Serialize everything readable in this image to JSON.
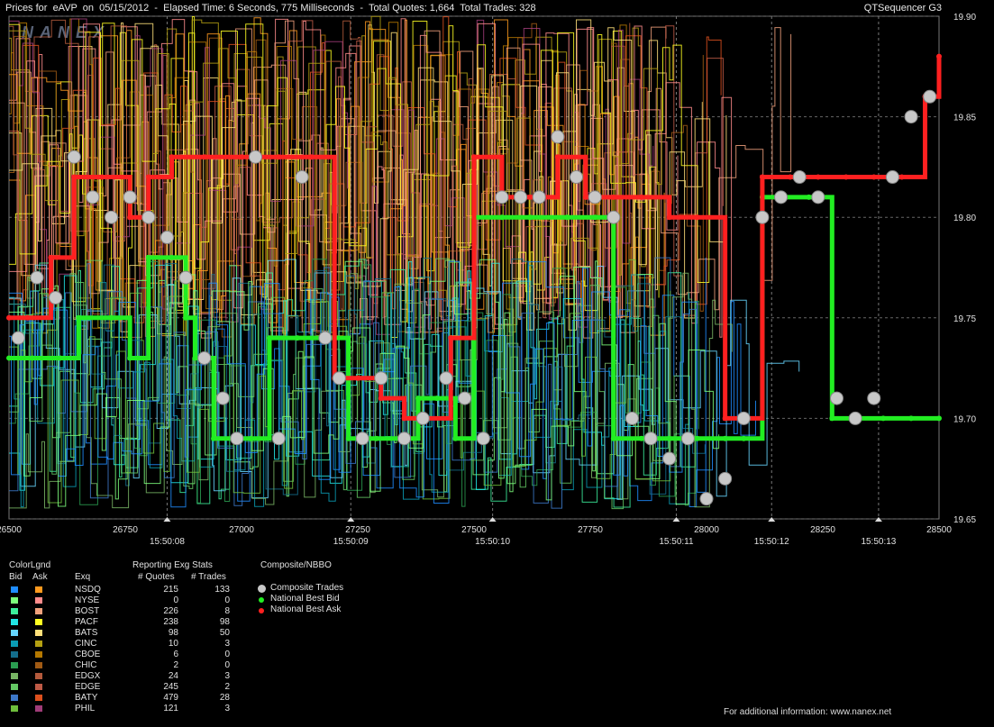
{
  "header": {
    "title": "Prices for  eAVP  on  05/15/2012  -  Elapsed Time: 6 Seconds, 775 Milliseconds  -  Total Quotes: 1,664  Total Trades: 328",
    "app": "QTSequencer G3"
  },
  "watermark": "NANEX",
  "chart_data": {
    "type": "line",
    "y_axis": {
      "min": 19.65,
      "max": 19.9,
      "ticks": [
        "19.90",
        "19.85",
        "19.80",
        "19.75",
        "19.70",
        "19.65"
      ]
    },
    "x_axis": {
      "min": 26500,
      "max": 28500,
      "ticks": [
        "26500",
        "26750",
        "27000",
        "27250",
        "27500",
        "27750",
        "28000",
        "28250",
        "28500"
      ],
      "time_labels": [
        {
          "at": 26840,
          "label": "15:50:08"
        },
        {
          "at": 27235,
          "label": "15:50:09"
        },
        {
          "at": 27540,
          "label": "15:50:10"
        },
        {
          "at": 27935,
          "label": "15:50:11"
        },
        {
          "at": 28140,
          "label": "15:50:12"
        },
        {
          "at": 28370,
          "label": "15:50:13"
        }
      ]
    },
    "series": [
      {
        "name": "National Best Bid",
        "color": "#22ee22",
        "points": [
          [
            26500,
            19.73
          ],
          [
            26550,
            19.73
          ],
          [
            26610,
            19.73
          ],
          [
            26650,
            19.75
          ],
          [
            26720,
            19.75
          ],
          [
            26760,
            19.73
          ],
          [
            26800,
            19.78
          ],
          [
            26850,
            19.78
          ],
          [
            26880,
            19.75
          ],
          [
            26900,
            19.73
          ],
          [
            26940,
            19.69
          ],
          [
            26980,
            19.69
          ],
          [
            27020,
            19.69
          ],
          [
            27060,
            19.74
          ],
          [
            27120,
            19.74
          ],
          [
            27180,
            19.74
          ],
          [
            27230,
            19.69
          ],
          [
            27290,
            19.69
          ],
          [
            27340,
            19.69
          ],
          [
            27380,
            19.71
          ],
          [
            27420,
            19.71
          ],
          [
            27460,
            19.69
          ],
          [
            27500,
            19.8
          ],
          [
            27560,
            19.8
          ],
          [
            27620,
            19.8
          ],
          [
            27700,
            19.8
          ],
          [
            27760,
            19.8
          ],
          [
            27800,
            19.69
          ],
          [
            27860,
            19.69
          ],
          [
            27920,
            19.69
          ],
          [
            27980,
            19.69
          ],
          [
            28040,
            19.69
          ],
          [
            28080,
            19.69
          ],
          [
            28120,
            19.81
          ],
          [
            28170,
            19.81
          ],
          [
            28220,
            19.81
          ],
          [
            28270,
            19.7
          ],
          [
            28320,
            19.7
          ],
          [
            28380,
            19.7
          ],
          [
            28440,
            19.7
          ],
          [
            28500,
            19.7
          ]
        ]
      },
      {
        "name": "National Best Ask",
        "color": "#ff2020",
        "points": [
          [
            26500,
            19.75
          ],
          [
            26540,
            19.75
          ],
          [
            26590,
            19.78
          ],
          [
            26640,
            19.82
          ],
          [
            26700,
            19.82
          ],
          [
            26760,
            19.8
          ],
          [
            26800,
            19.82
          ],
          [
            26850,
            19.83
          ],
          [
            26920,
            19.83
          ],
          [
            27000,
            19.83
          ],
          [
            27080,
            19.83
          ],
          [
            27150,
            19.83
          ],
          [
            27200,
            19.72
          ],
          [
            27250,
            19.72
          ],
          [
            27300,
            19.71
          ],
          [
            27350,
            19.7
          ],
          [
            27400,
            19.7
          ],
          [
            27450,
            19.74
          ],
          [
            27500,
            19.83
          ],
          [
            27560,
            19.81
          ],
          [
            27620,
            19.81
          ],
          [
            27680,
            19.83
          ],
          [
            27740,
            19.81
          ],
          [
            27800,
            19.81
          ],
          [
            27860,
            19.81
          ],
          [
            27920,
            19.8
          ],
          [
            27980,
            19.8
          ],
          [
            28040,
            19.7
          ],
          [
            28080,
            19.7
          ],
          [
            28120,
            19.82
          ],
          [
            28180,
            19.82
          ],
          [
            28240,
            19.82
          ],
          [
            28300,
            19.82
          ],
          [
            28360,
            19.82
          ],
          [
            28420,
            19.82
          ],
          [
            28470,
            19.86
          ],
          [
            28500,
            19.88
          ]
        ]
      },
      {
        "name": "Composite Trades",
        "color": "#c8c8c8",
        "points": [
          [
            26520,
            19.74
          ],
          [
            26560,
            19.77
          ],
          [
            26600,
            19.76
          ],
          [
            26640,
            19.83
          ],
          [
            26680,
            19.81
          ],
          [
            26720,
            19.8
          ],
          [
            26760,
            19.81
          ],
          [
            26800,
            19.8
          ],
          [
            26840,
            19.79
          ],
          [
            26880,
            19.77
          ],
          [
            26920,
            19.73
          ],
          [
            26960,
            19.71
          ],
          [
            26990,
            19.69
          ],
          [
            27030,
            19.83
          ],
          [
            27080,
            19.69
          ],
          [
            27130,
            19.82
          ],
          [
            27180,
            19.74
          ],
          [
            27210,
            19.72
          ],
          [
            27260,
            19.69
          ],
          [
            27300,
            19.72
          ],
          [
            27350,
            19.69
          ],
          [
            27390,
            19.7
          ],
          [
            27440,
            19.72
          ],
          [
            27480,
            19.71
          ],
          [
            27520,
            19.69
          ],
          [
            27560,
            19.81
          ],
          [
            27600,
            19.81
          ],
          [
            27640,
            19.81
          ],
          [
            27680,
            19.84
          ],
          [
            27720,
            19.82
          ],
          [
            27760,
            19.81
          ],
          [
            27800,
            19.8
          ],
          [
            27840,
            19.7
          ],
          [
            27880,
            19.69
          ],
          [
            27920,
            19.68
          ],
          [
            27960,
            19.69
          ],
          [
            28000,
            19.66
          ],
          [
            28040,
            19.67
          ],
          [
            28080,
            19.7
          ],
          [
            28120,
            19.8
          ],
          [
            28160,
            19.81
          ],
          [
            28200,
            19.82
          ],
          [
            28240,
            19.81
          ],
          [
            28280,
            19.71
          ],
          [
            28320,
            19.7
          ],
          [
            28360,
            19.71
          ],
          [
            28400,
            19.82
          ],
          [
            28440,
            19.85
          ],
          [
            28480,
            19.86
          ]
        ]
      }
    ]
  },
  "legend": {
    "headers": {
      "colorlgnd": "ColorLgnd",
      "bid": "Bid",
      "ask": "Ask",
      "exq": "Exq",
      "stats": "Reporting Exg Stats",
      "quotes": "# Quotes",
      "trades": "# Trades",
      "composite": "Composite/NBBO"
    },
    "rows": [
      {
        "exq": "NSDQ",
        "bid": "#1e8cff",
        "ask": "#ff9a1e",
        "quotes": "215",
        "trades": "133"
      },
      {
        "exq": "NYSE",
        "bid": "#7cff7c",
        "ask": "#ff8c8c",
        "quotes": "0",
        "trades": "0"
      },
      {
        "exq": "BOST",
        "bid": "#3cf09c",
        "ask": "#f0a07c",
        "quotes": "226",
        "trades": "8"
      },
      {
        "exq": "PACF",
        "bid": "#22e6e6",
        "ask": "#ffff22",
        "quotes": "238",
        "trades": "98"
      },
      {
        "exq": "BATS",
        "bid": "#66d6ff",
        "ask": "#ffe07a",
        "quotes": "98",
        "trades": "50"
      },
      {
        "exq": "CINC",
        "bid": "#0a9cb4",
        "ask": "#b4a012",
        "quotes": "10",
        "trades": "3"
      },
      {
        "exq": "CBOE",
        "bid": "#146e8c",
        "ask": "#b47800",
        "quotes": "6",
        "trades": "0"
      },
      {
        "exq": "CHIC",
        "bid": "#2a9c50",
        "ask": "#a05a14",
        "quotes": "2",
        "trades": "0"
      },
      {
        "exq": "EDGX",
        "bid": "#78b464",
        "ask": "#b45a3c",
        "quotes": "24",
        "trades": "3"
      },
      {
        "exq": "EDGE",
        "bid": "#64c864",
        "ask": "#be5a46",
        "quotes": "245",
        "trades": "2"
      },
      {
        "exq": "BATY",
        "bid": "#3c78c8",
        "ask": "#dc501e",
        "quotes": "479",
        "trades": "28"
      },
      {
        "exq": "PHIL",
        "bid": "#6ebe3c",
        "ask": "#a03c78",
        "quotes": "121",
        "trades": "3"
      }
    ],
    "nbbo": [
      {
        "label": "Composite Trades",
        "color": "#c8c8c8"
      },
      {
        "label": "National Best Bid",
        "color": "#22ee22"
      },
      {
        "label": "National Best Ask",
        "color": "#ff2020"
      }
    ]
  },
  "footer": "For additional information: www.nanex.net"
}
